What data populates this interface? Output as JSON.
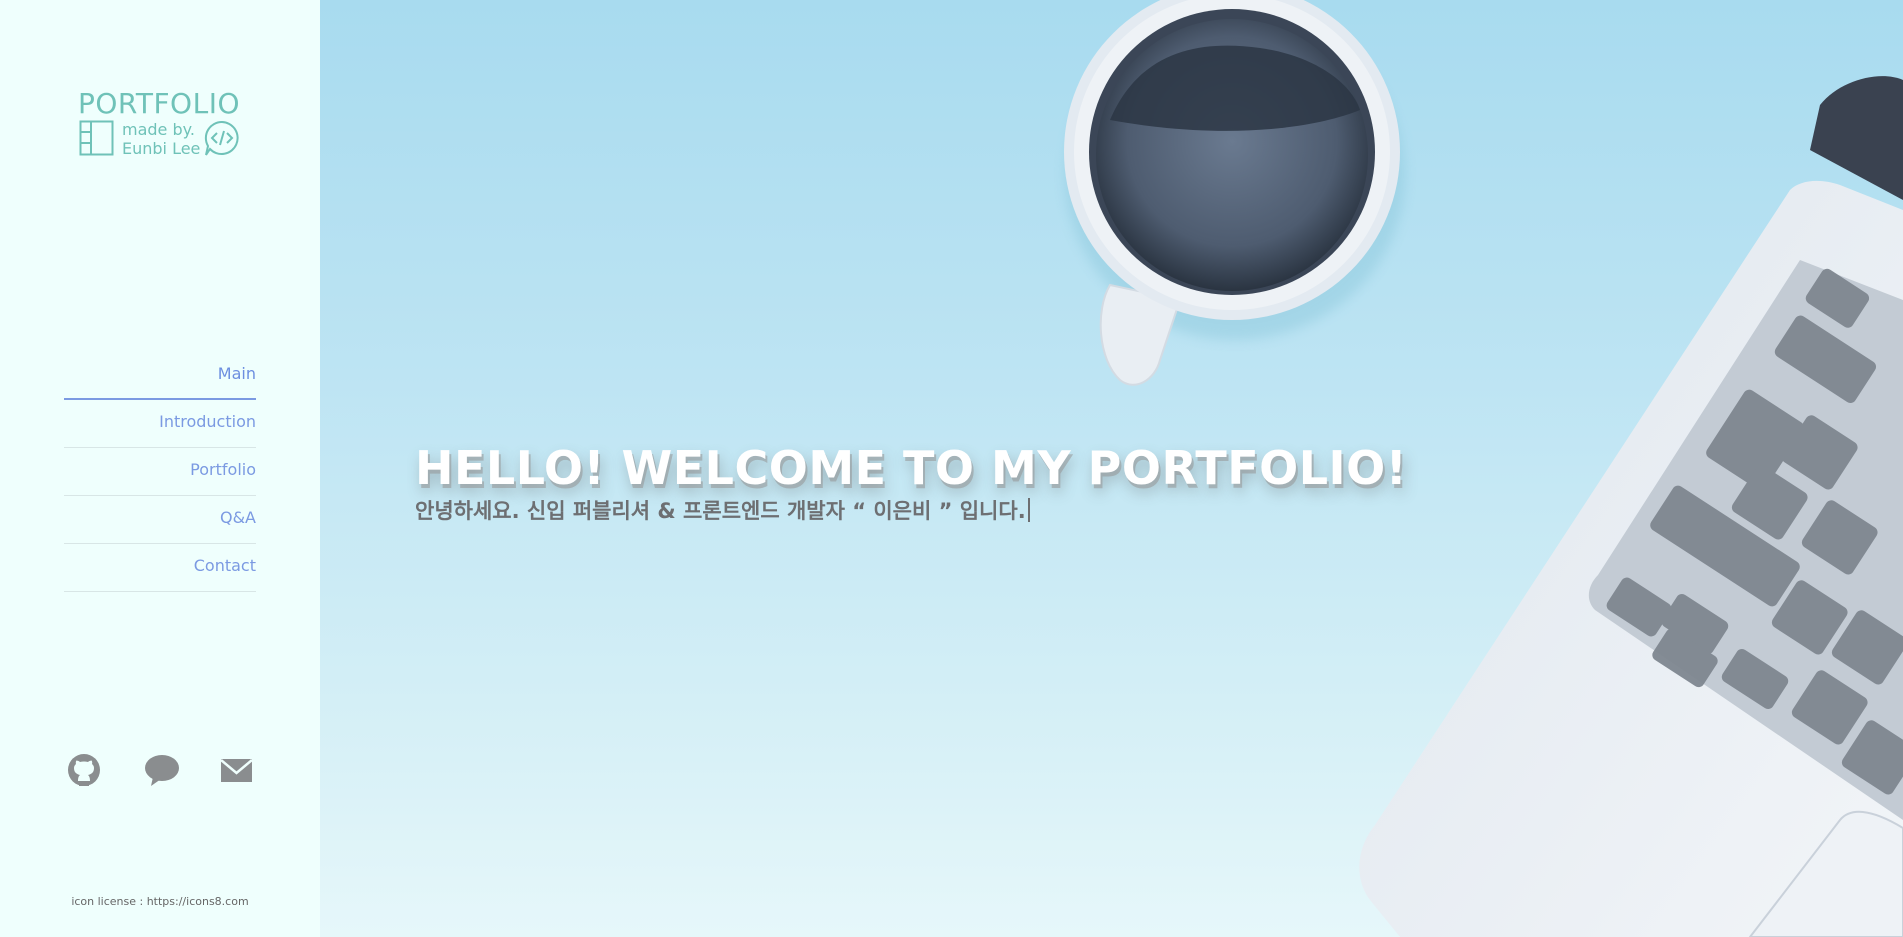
{
  "logo": {
    "title": "PORTFOLIO",
    "made_by": "made by.",
    "author": "Eunbi Lee",
    "color": "#6fc2b8"
  },
  "nav": {
    "items": [
      {
        "label": "Main",
        "active": true
      },
      {
        "label": "Introduction",
        "active": false
      },
      {
        "label": "Portfolio",
        "active": false
      },
      {
        "label": "Q&A",
        "active": false
      },
      {
        "label": "Contact",
        "active": false
      }
    ],
    "accent": "#7b9ae2"
  },
  "social": {
    "icons": [
      "github-icon",
      "chat-icon",
      "mail-icon"
    ],
    "color": "#8a8d8f"
  },
  "license": "icon license : https://icons8.com",
  "hero": {
    "title": "HELLO! WELCOME TO MY PORTFOLIO!",
    "subtitle": "안녕하세요. 신입 퍼블리셔 & 프론트엔드 개발자 “ 이은비 ” 입니다."
  }
}
